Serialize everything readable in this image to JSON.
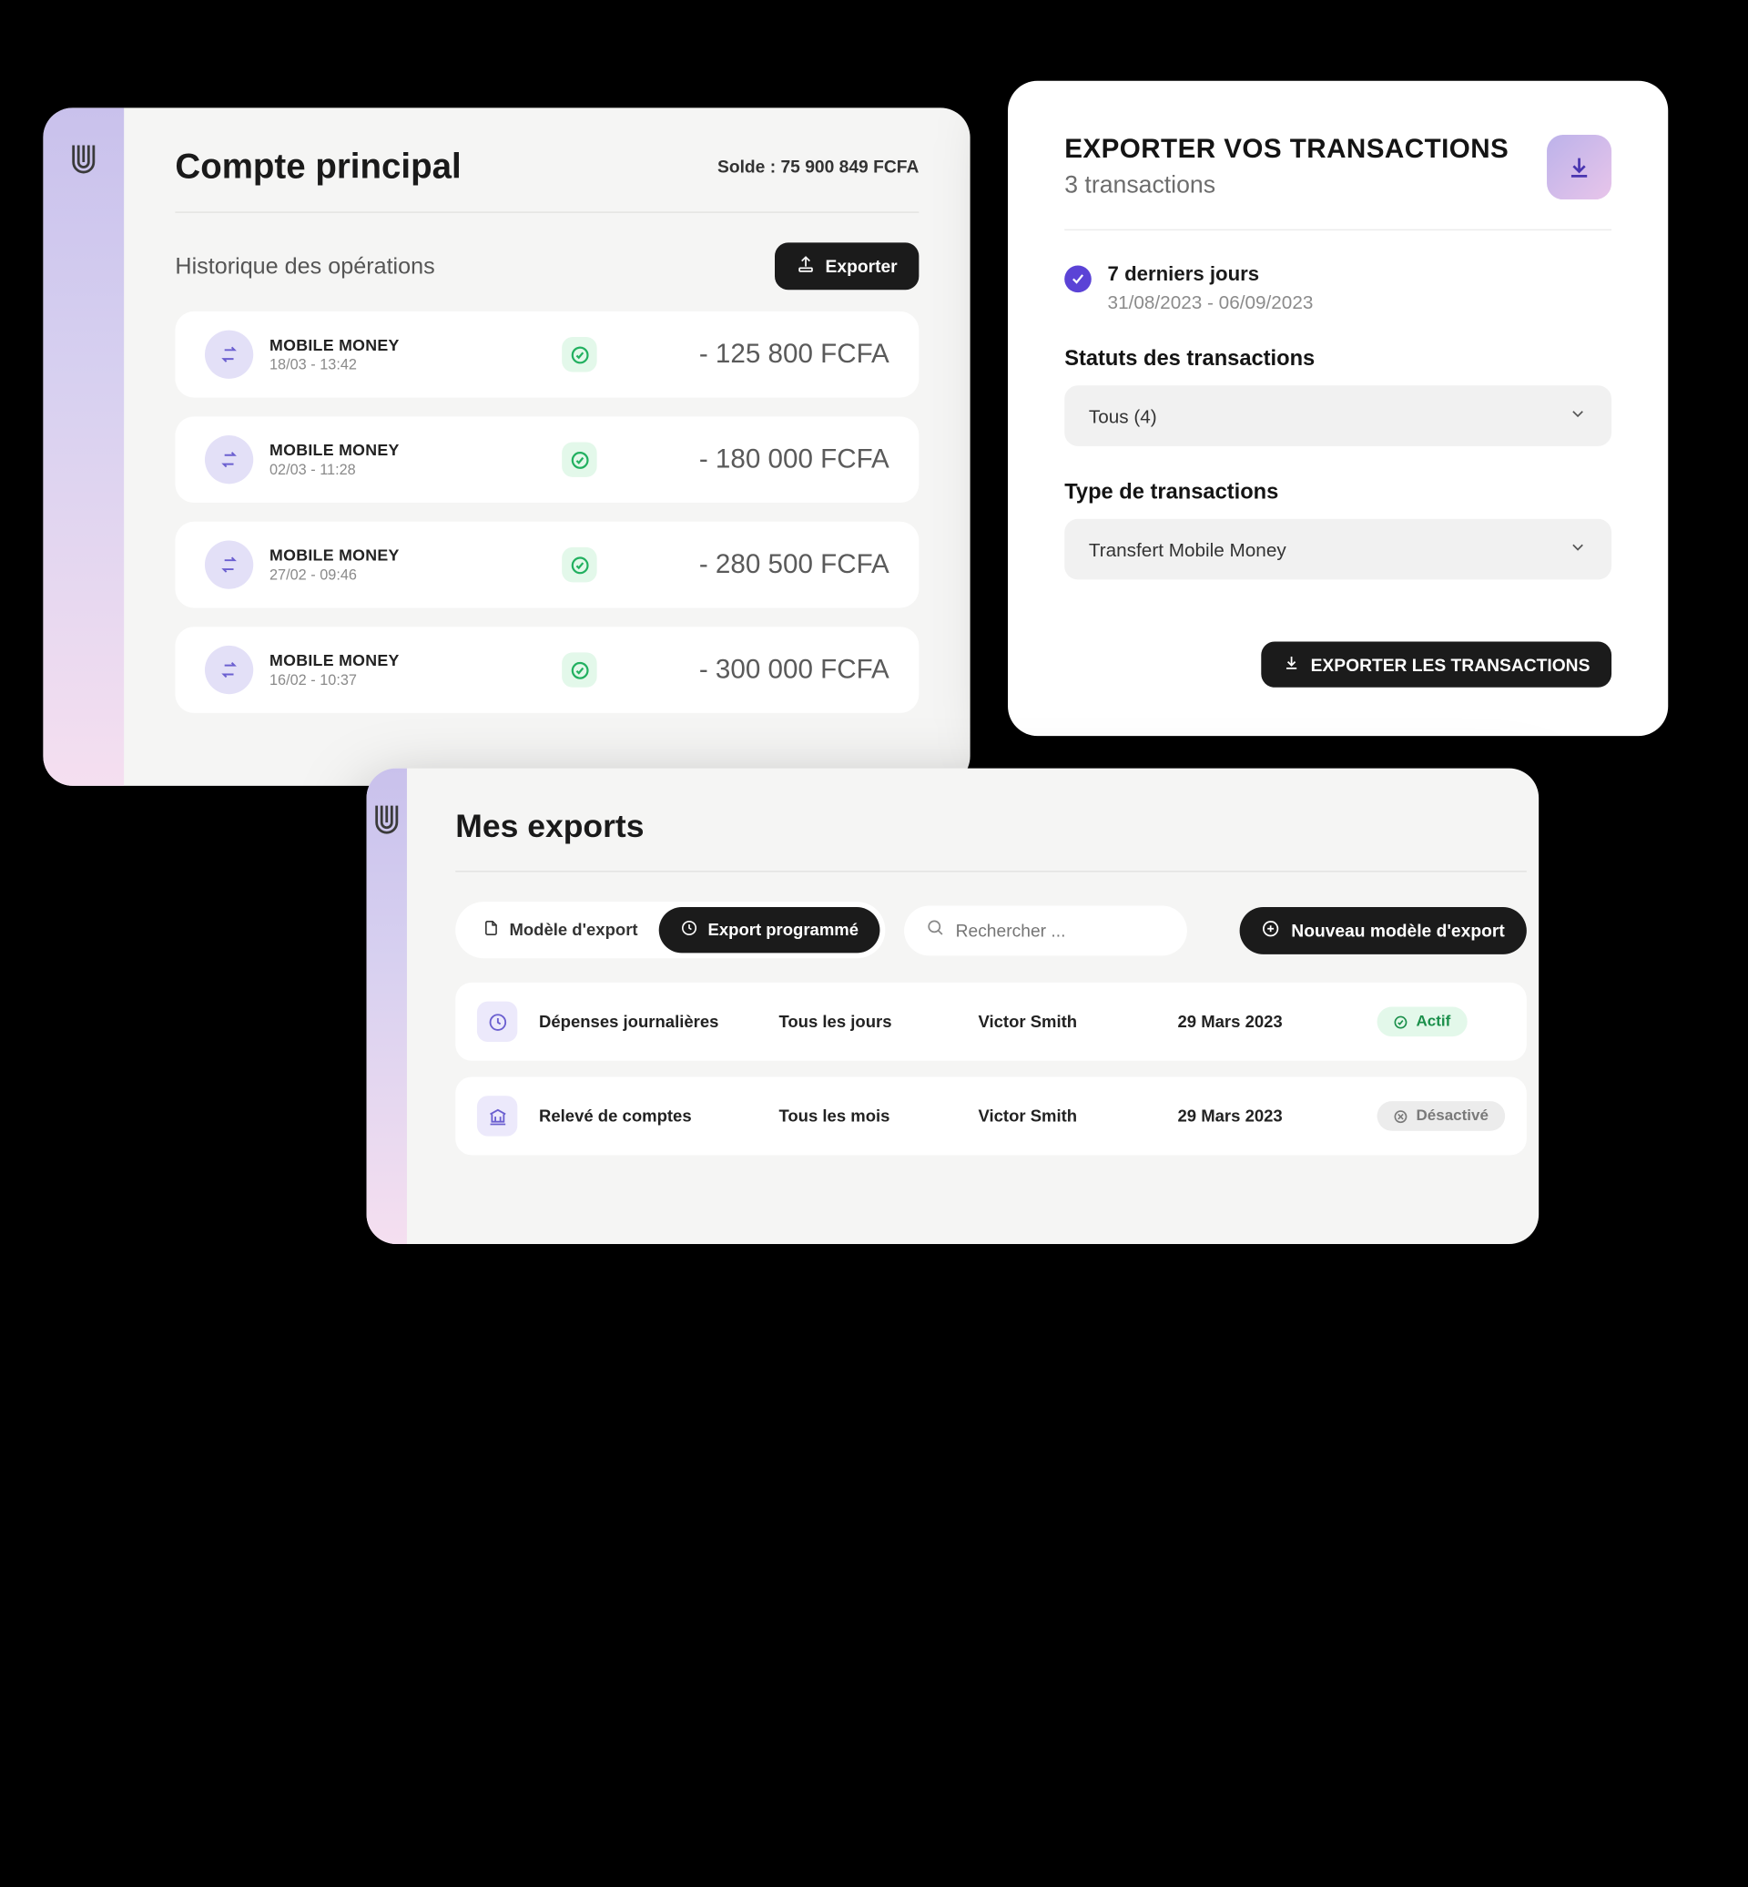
{
  "account": {
    "title": "Compte principal",
    "balance_label": "Solde : 75 900 849 FCFA",
    "history_label": "Historique des opérations",
    "export_button": "Exporter",
    "ops": [
      {
        "type": "MOBILE MONEY",
        "date": "18/03 - 13:42",
        "amount": "- 125 800 FCFA"
      },
      {
        "type": "MOBILE MONEY",
        "date": "02/03 - 11:28",
        "amount": "- 180 000 FCFA"
      },
      {
        "type": "MOBILE MONEY",
        "date": "27/02 - 09:46",
        "amount": "- 280 500 FCFA"
      },
      {
        "type": "MOBILE MONEY",
        "date": "16/02 - 10:37",
        "amount": "- 300 000 FCFA"
      }
    ]
  },
  "export": {
    "title": "EXPORTER VOS TRANSACTIONS",
    "subtitle": "3 transactions",
    "period_label": "7 derniers jours",
    "period_range": "31/08/2023 - 06/09/2023",
    "status_label": "Statuts des transactions",
    "status_value": "Tous (4)",
    "type_label": "Type de transactions",
    "type_value": "Transfert Mobile Money",
    "submit": "EXPORTER LES TRANSACTIONS"
  },
  "list": {
    "title": "Mes exports",
    "tab_model": "Modèle d'export",
    "tab_schedule": "Export programmé",
    "search_placeholder": "Rechercher ...",
    "new_button": "Nouveau modèle d'export",
    "rows": [
      {
        "name": "Dépenses journalières",
        "freq": "Tous les jours",
        "owner": "Victor Smith",
        "date": "29 Mars 2023",
        "status": "Actif",
        "status_kind": "active",
        "icon": "clock"
      },
      {
        "name": "Relevé de comptes",
        "freq": "Tous les mois",
        "owner": "Victor Smith",
        "date": "29 Mars 2023",
        "status": "Désactivé",
        "status_kind": "inactive",
        "icon": "bank"
      }
    ]
  }
}
